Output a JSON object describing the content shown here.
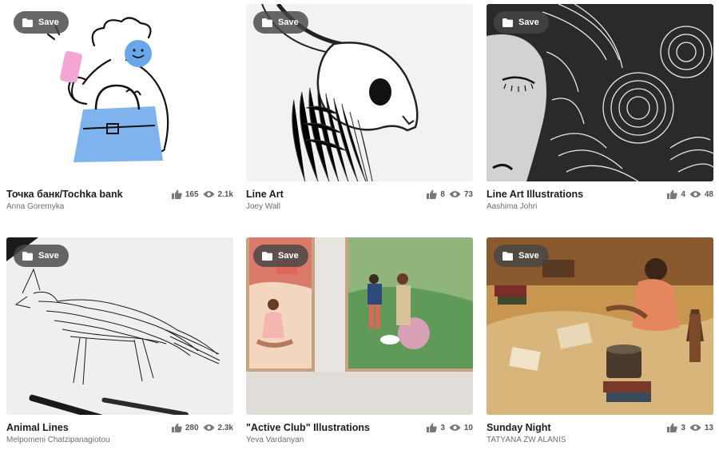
{
  "save_label": "Save",
  "projects": [
    {
      "title": "Точка банк/Tochka bank",
      "owner": "Anna Goremyka",
      "likes": "165",
      "views": "2.1k",
      "thumb_icon": "woman-with-phone-and-bag-illustration"
    },
    {
      "title": "Line Art",
      "owner": "Joey Wall",
      "likes": "8",
      "views": "73",
      "thumb_icon": "horned-skull-creature-illustration"
    },
    {
      "title": "Line Art Illustrations",
      "owner": "Aashima Johri",
      "likes": "4",
      "views": "48",
      "thumb_icon": "woman-with-swirling-hair-illustration"
    },
    {
      "title": "Animal Lines",
      "owner": "Melpomeni Chatzipanagiotou",
      "likes": "280",
      "views": "2.3k",
      "thumb_icon": "fox-line-drawing-with-pens"
    },
    {
      "title": "\"Active Club\" Illustrations",
      "owner": "Yeva Vardanyan",
      "likes": "3",
      "views": "10",
      "thumb_icon": "framed-posters-yoga-and-couple"
    },
    {
      "title": "Sunday Night",
      "owner": "TATYANA ZW ALANIS",
      "likes": "3",
      "views": "13",
      "thumb_icon": "woman-sitting-in-messy-room-illustration"
    }
  ],
  "colors": {
    "title": "#1c1c1c",
    "owner": "#6e6e6e",
    "stats": "#555555",
    "save_bg": "#464646"
  }
}
